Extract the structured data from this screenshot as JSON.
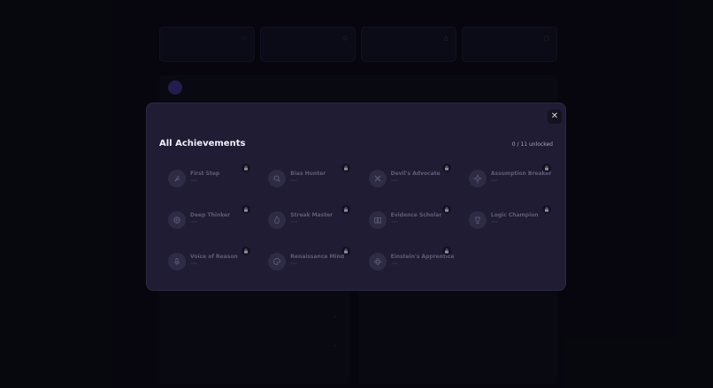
{
  "modal": {
    "title": "All Achievements",
    "unlock_count": "0 / 11 unlocked",
    "close_label": "✕"
  },
  "achievements": [
    {
      "name": "First Step",
      "icon": "footprint-icon"
    },
    {
      "name": "Bias Hunter",
      "icon": "search-icon"
    },
    {
      "name": "Devil's Advocate",
      "icon": "swords-icon"
    },
    {
      "name": "Assumption Breaker",
      "icon": "sparkle-icon"
    },
    {
      "name": "Deep Thinker",
      "icon": "brain-icon"
    },
    {
      "name": "Streak Master",
      "icon": "flame-icon"
    },
    {
      "name": "Evidence Scholar",
      "icon": "book-icon"
    },
    {
      "name": "Logic Champion",
      "icon": "trophy-icon"
    },
    {
      "name": "Voice of Reason",
      "icon": "mic-icon"
    },
    {
      "name": "Renaissance Mind",
      "icon": "palette-icon"
    },
    {
      "name": "Einstein's Apprentice",
      "icon": "atom-icon"
    }
  ],
  "colors": {
    "modal_bg": "#1f1c33",
    "badge_bg": "#2e2b44",
    "locked_text": "#5f5c78",
    "title_text": "#f1eff8",
    "accent_gold": "#8b6a1e"
  }
}
